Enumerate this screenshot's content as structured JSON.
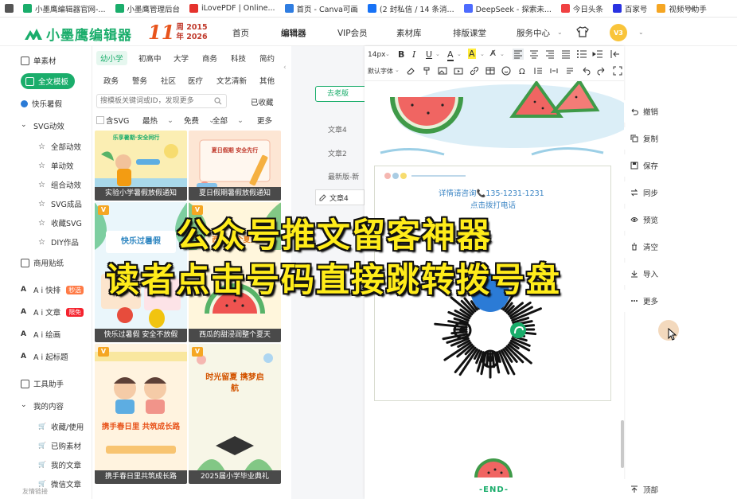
{
  "bookmarks": [
    {
      "label": "",
      "icon": "apps-grid-icon",
      "color": "#555555"
    },
    {
      "label": "小墨鹰编辑器官网-...",
      "icon": "xiaomoying-favicon",
      "color": "#1aad6b"
    },
    {
      "label": "小墨鹰管理后台",
      "icon": "xiaomoying-favicon",
      "color": "#1aad6b"
    },
    {
      "label": "iLovePDF | Online...",
      "icon": "heart-favicon",
      "color": "#e5322d"
    },
    {
      "label": "首页 - Canva可画",
      "icon": "canva-favicon",
      "color": "#2f7de1"
    },
    {
      "label": "(2 封私信 / 14 条消...",
      "icon": "zhihu-favicon",
      "color": "#1772f6"
    },
    {
      "label": "DeepSeek - 探索未...",
      "icon": "deepseek-favicon",
      "color": "#4d6bfe"
    },
    {
      "label": "今日头条",
      "icon": "toutiao-favicon",
      "color": "#f04142"
    },
    {
      "label": "百家号",
      "icon": "baijiahao-favicon",
      "color": "#2932e1"
    },
    {
      "label": "视频号助手",
      "icon": "channels-favicon",
      "color": "#f5a623"
    }
  ],
  "bookmarks_more": "»",
  "header": {
    "logo_text": "小墨鹰编辑器",
    "anniv_big": "11",
    "anniv_line1": "周 2015",
    "anniv_line2": "年 2026",
    "nav": [
      "首页",
      "编辑器",
      "VIP会员",
      "素材库",
      "排版课堂",
      "服务中心"
    ],
    "service_caret": "⌄",
    "vip_text": "V3",
    "caret": "⌄"
  },
  "sidebar": {
    "items": [
      {
        "label": "单素材",
        "icon": "grid-icon",
        "level": 0
      },
      {
        "label": "全文模板",
        "icon": "layout-icon",
        "level": 0,
        "active": true
      },
      {
        "label": "快乐暑假",
        "icon": "ball-icon",
        "level": 0
      },
      {
        "label": "SVG动效",
        "icon": "chevron-down-icon",
        "level": 0
      },
      {
        "label": "全部动效",
        "icon": "star-icon",
        "level": 1
      },
      {
        "label": "单动效",
        "icon": "star-icon",
        "level": 1
      },
      {
        "label": "组合动效",
        "icon": "star-icon",
        "level": 1
      },
      {
        "label": "SVG成品",
        "icon": "star-icon",
        "level": 1
      },
      {
        "label": "收藏SVG",
        "icon": "star-icon",
        "level": 1
      },
      {
        "label": "DIY作品",
        "icon": "star-icon",
        "level": 1
      },
      {
        "label": "商用贴纸",
        "icon": "sticker-icon",
        "level": 0
      },
      {
        "label": "A i 快排",
        "icon": "ai-icon",
        "level": 0,
        "badge": "秒选",
        "badge_color": "#ff7a45"
      },
      {
        "label": "A i 文章",
        "icon": "ai-doc-icon",
        "level": 0,
        "badge": "限免",
        "badge_color": "#f5222d"
      },
      {
        "label": "A i 绘画",
        "icon": "ai-paint-icon",
        "level": 0
      },
      {
        "label": "A i 起标题",
        "icon": "ai-title-icon",
        "level": 0
      },
      {
        "label": "工具助手",
        "icon": "tools-icon",
        "level": 0
      },
      {
        "label": "我的内容",
        "icon": "chevron-down-icon",
        "level": 0
      },
      {
        "label": "收藏/使用",
        "icon": "cart-icon",
        "level": 1
      },
      {
        "label": "已购素材",
        "icon": "cart-icon",
        "level": 1
      },
      {
        "label": "我的文章",
        "icon": "cart-icon",
        "level": 1
      },
      {
        "label": "微信文章",
        "icon": "cart-icon",
        "level": 1
      }
    ],
    "footer": "友情链接"
  },
  "templates": {
    "categories_row1": [
      "幼小学",
      "初高中",
      "大学",
      "商务",
      "科技",
      "简约"
    ],
    "categories_row2": [
      "政务",
      "警务",
      "社区",
      "医疗",
      "文艺清新",
      "其他"
    ],
    "search_placeholder": "搜模板关键词或ID，发现更多",
    "collected": "已收藏",
    "filters": {
      "svg": "含SVG",
      "hot": "最热",
      "free": "免费",
      "all": "全部",
      "more": "更多"
    },
    "cards": [
      {
        "caption": "实验小学暑假放假通知",
        "title": "乐享暑期·安全同行",
        "bg": "#fdf3c7"
      },
      {
        "caption": "夏日假期暑假放假通知",
        "title": "夏日假期 安全先行",
        "bg": "#fdeee0"
      },
      {
        "caption": "快乐过暑假 安全不放假",
        "title": "快乐过暑假",
        "bg": "#e8f4fb"
      },
      {
        "caption": "西瓜的甜浸润整个夏天",
        "title": "西瓜 整个夏天",
        "bg": "#fff8e3"
      },
      {
        "caption": "携手春日里共筑成长路",
        "title": "携手春日里 共筑成长路",
        "bg": "#fff4e2"
      },
      {
        "caption": "2025届小学毕业典礼",
        "title": "时光留夏 携梦启航",
        "bg": "#f5f7e8"
      }
    ]
  },
  "doc_panel": {
    "old_button": "去老版",
    "tabs": [
      "文章4",
      "文章2",
      "最新版-新",
      "文章4"
    ]
  },
  "toolbar": {
    "font_size": "14px",
    "bold": "B",
    "italic": "I",
    "underline": "U",
    "font_family": "默认字体"
  },
  "editor": {
    "contact_line1": "详情请咨询",
    "phone": "135-1231-1231",
    "contact_line2": "点击拨打电话",
    "end": "-END-"
  },
  "right_rail": [
    {
      "label": "撤销",
      "icon": "undo-icon"
    },
    {
      "label": "复制",
      "icon": "copy-icon"
    },
    {
      "label": "保存",
      "icon": "save-icon"
    },
    {
      "label": "同步",
      "icon": "sync-icon"
    },
    {
      "label": "预览",
      "icon": "eye-icon"
    },
    {
      "label": "清空",
      "icon": "trash-icon"
    },
    {
      "label": "导入",
      "icon": "import-icon"
    },
    {
      "label": "更多",
      "icon": "more-icon"
    }
  ],
  "back_to_top": "顶部",
  "overlay": {
    "line1": "公众号推文留客神器",
    "line2": "读者点击号码直接跳转拨号盘"
  }
}
